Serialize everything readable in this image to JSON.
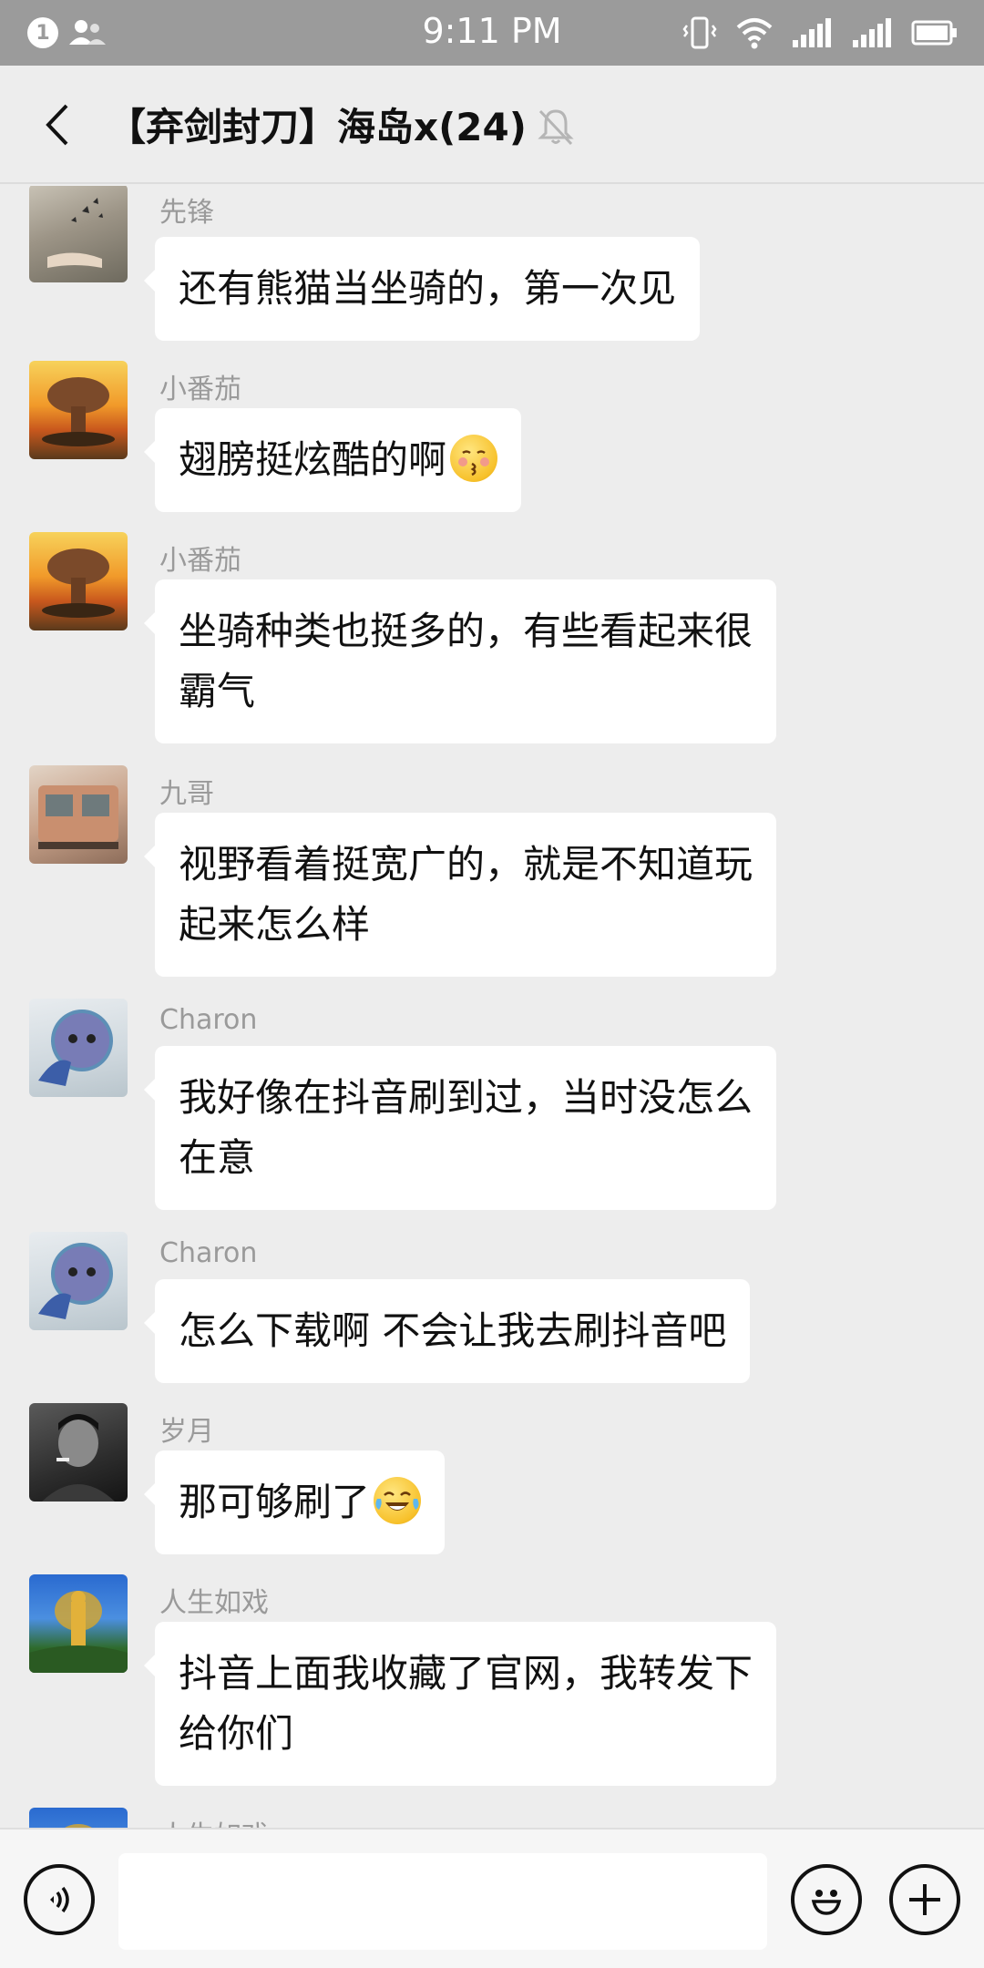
{
  "status_bar": {
    "notification_count": "1",
    "time": "9:11 PM"
  },
  "header": {
    "title": "【弃剑封刀】海岛x(24)"
  },
  "messages": [
    {
      "sender": "先锋",
      "lines": [
        "还有熊猫当坐骑的，第一次见"
      ],
      "avatar": "hand-butterflies-avatar"
    },
    {
      "sender": "小番茄",
      "lines": [
        "翅膀挺炫酷的啊"
      ],
      "emoji": "kissing-face-emoji",
      "avatar": "mushroom-cloud-avatar"
    },
    {
      "sender": "小番茄",
      "lines": [
        "坐骑种类也挺多的，有些看起来很",
        "霸气"
      ],
      "avatar": "mushroom-cloud-avatar"
    },
    {
      "sender": "九哥",
      "lines": [
        "视野看着挺宽广的，就是不知道玩",
        "起来怎么样"
      ],
      "avatar": "train-avatar"
    },
    {
      "sender": "Charon",
      "lines": [
        "我好像在抖音刷到过，当时没怎么",
        "在意"
      ],
      "avatar": "stitch-avatar"
    },
    {
      "sender": "Charon",
      "lines": [
        "怎么下载啊 不会让我去刷抖音吧"
      ],
      "avatar": "stitch-avatar"
    },
    {
      "sender": "岁月",
      "lines": [
        "那可够刷了"
      ],
      "emoji": "tears-of-joy-emoji",
      "avatar": "man-portrait-avatar"
    },
    {
      "sender": "人生如戏",
      "lines": [
        "抖音上面我收藏了官网，我转发下",
        "给你们"
      ],
      "avatar": "statue-avatar"
    },
    {
      "sender": "人生如戏",
      "lines": [],
      "avatar": "statue-avatar"
    }
  ],
  "input": {
    "placeholder": ""
  },
  "colors": {
    "background": "#ededed",
    "status_bar": "#9b9b9b",
    "bubble": "#ffffff",
    "sender_text": "#9a9a9a"
  }
}
